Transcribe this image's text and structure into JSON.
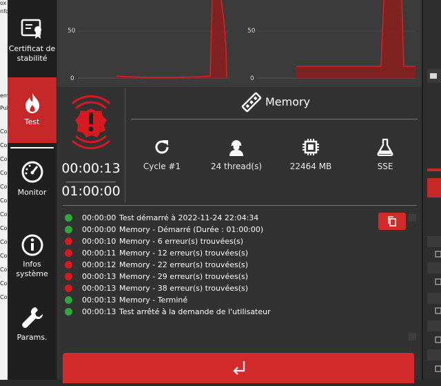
{
  "bg_window": {
    "fragments": [
      "ox",
      "nfo",
      "em",
      "Pul",
      "Co",
      "Co",
      "Co",
      "Co",
      "Co",
      "Co",
      "Co",
      "Co",
      "Co",
      "Co",
      "Co",
      "Co",
      "Co",
      "Co",
      "xes",
      "xes",
      "xes"
    ]
  },
  "sidebar": {
    "items": [
      {
        "label": "Certificat de stabilité",
        "icon": "certificate-icon"
      },
      {
        "label": "Test",
        "icon": "flame-icon",
        "active": true
      },
      {
        "label": "Monitor",
        "icon": "speedometer-icon"
      },
      {
        "label": "Infos système",
        "icon": "info-icon"
      },
      {
        "label": "Params.",
        "icon": "wrench-icon"
      }
    ]
  },
  "charts": {
    "left": {
      "ticks": [
        "50",
        "0"
      ]
    },
    "right": {
      "ticks": [
        "50",
        "0"
      ]
    }
  },
  "status": {
    "elapsed": "00:00:13",
    "duration": "01:00:00",
    "accent_color": "#d71920"
  },
  "test": {
    "title": "Memory",
    "stats": [
      {
        "icon": "refresh-icon",
        "value": "Cycle #1"
      },
      {
        "icon": "worker-icon",
        "value": "24 thread(s)"
      },
      {
        "icon": "chip-icon",
        "value": "22464 MB"
      },
      {
        "icon": "flask-icon",
        "value": "SSE"
      }
    ]
  },
  "log": [
    {
      "status": "ok",
      "time": "00:00:00",
      "message": "Test démarré à 2022-11-24 22:04:34"
    },
    {
      "status": "ok",
      "time": "00:00:00",
      "message": "Memory - Démarré (Durée : 01:00:00)"
    },
    {
      "status": "error",
      "time": "00:00:10",
      "message": "Memory - 6 erreur(s) trouvées(s)"
    },
    {
      "status": "error",
      "time": "00:00:11",
      "message": "Memory - 12 erreur(s) trouvées(s)"
    },
    {
      "status": "error",
      "time": "00:00:12",
      "message": "Memory - 22 erreur(s) trouvées(s)"
    },
    {
      "status": "error",
      "time": "00:00:13",
      "message": "Memory - 29 erreur(s) trouvées(s)"
    },
    {
      "status": "error",
      "time": "00:00:13",
      "message": "Memory - 38 erreur(s) trouvées(s)"
    },
    {
      "status": "ok",
      "time": "00:00:13",
      "message": "Memory - Terminé"
    },
    {
      "status": "ok",
      "time": "00:00:13",
      "message": "Test arrêté à la demande de l'utilisateur"
    }
  ],
  "buttons": {
    "copy_icon": "copy-icon",
    "back_icon": "return-arrow-icon"
  },
  "colors": {
    "accent": "#d32b2b",
    "ok": "#2fa83a",
    "error": "#d71920"
  }
}
